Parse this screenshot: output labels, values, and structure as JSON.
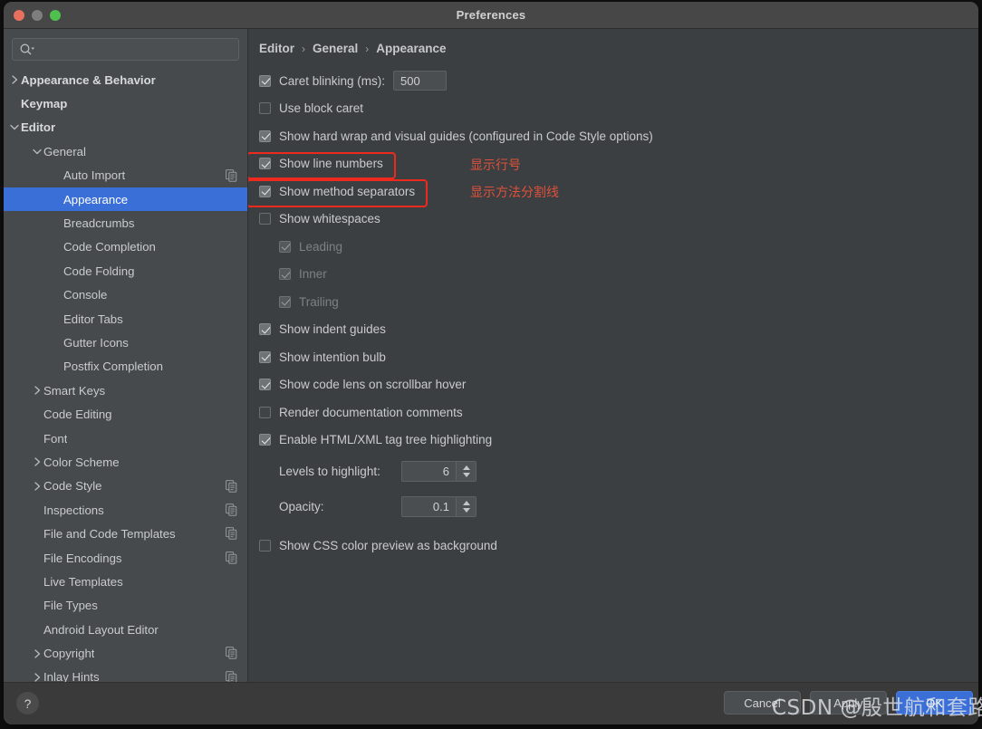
{
  "window": {
    "title": "Preferences",
    "traffic_lights": [
      "close-red",
      "minimize-gray",
      "maximize-green"
    ]
  },
  "search": {
    "value": "",
    "placeholder": "",
    "icon": "search-icon-with-dropdown"
  },
  "sidebar": {
    "items": [
      {
        "label": "Appearance & Behavior",
        "level": 0,
        "twisty": "collapsed",
        "bold": true,
        "selected": false,
        "copy_icon": false
      },
      {
        "label": "Keymap",
        "level": 0,
        "twisty": "none",
        "bold": true,
        "selected": false,
        "copy_icon": false
      },
      {
        "label": "Editor",
        "level": 0,
        "twisty": "expanded",
        "bold": true,
        "selected": false,
        "copy_icon": false
      },
      {
        "label": "General",
        "level": 1,
        "twisty": "expanded",
        "bold": false,
        "selected": false,
        "copy_icon": false
      },
      {
        "label": "Auto Import",
        "level": 2,
        "twisty": "none",
        "bold": false,
        "selected": false,
        "copy_icon": true
      },
      {
        "label": "Appearance",
        "level": 2,
        "twisty": "none",
        "bold": false,
        "selected": true,
        "copy_icon": false
      },
      {
        "label": "Breadcrumbs",
        "level": 2,
        "twisty": "none",
        "bold": false,
        "selected": false,
        "copy_icon": false
      },
      {
        "label": "Code Completion",
        "level": 2,
        "twisty": "none",
        "bold": false,
        "selected": false,
        "copy_icon": false
      },
      {
        "label": "Code Folding",
        "level": 2,
        "twisty": "none",
        "bold": false,
        "selected": false,
        "copy_icon": false
      },
      {
        "label": "Console",
        "level": 2,
        "twisty": "none",
        "bold": false,
        "selected": false,
        "copy_icon": false
      },
      {
        "label": "Editor Tabs",
        "level": 2,
        "twisty": "none",
        "bold": false,
        "selected": false,
        "copy_icon": false
      },
      {
        "label": "Gutter Icons",
        "level": 2,
        "twisty": "none",
        "bold": false,
        "selected": false,
        "copy_icon": false
      },
      {
        "label": "Postfix Completion",
        "level": 2,
        "twisty": "none",
        "bold": false,
        "selected": false,
        "copy_icon": false
      },
      {
        "label": "Smart Keys",
        "level": 1,
        "twisty": "collapsed",
        "bold": false,
        "selected": false,
        "copy_icon": false
      },
      {
        "label": "Code Editing",
        "level": 1,
        "twisty": "none",
        "bold": false,
        "selected": false,
        "copy_icon": false
      },
      {
        "label": "Font",
        "level": 1,
        "twisty": "none",
        "bold": false,
        "selected": false,
        "copy_icon": false
      },
      {
        "label": "Color Scheme",
        "level": 1,
        "twisty": "collapsed",
        "bold": false,
        "selected": false,
        "copy_icon": false
      },
      {
        "label": "Code Style",
        "level": 1,
        "twisty": "collapsed",
        "bold": false,
        "selected": false,
        "copy_icon": true
      },
      {
        "label": "Inspections",
        "level": 1,
        "twisty": "none",
        "bold": false,
        "selected": false,
        "copy_icon": true
      },
      {
        "label": "File and Code Templates",
        "level": 1,
        "twisty": "none",
        "bold": false,
        "selected": false,
        "copy_icon": true
      },
      {
        "label": "File Encodings",
        "level": 1,
        "twisty": "none",
        "bold": false,
        "selected": false,
        "copy_icon": true
      },
      {
        "label": "Live Templates",
        "level": 1,
        "twisty": "none",
        "bold": false,
        "selected": false,
        "copy_icon": false
      },
      {
        "label": "File Types",
        "level": 1,
        "twisty": "none",
        "bold": false,
        "selected": false,
        "copy_icon": false
      },
      {
        "label": "Android Layout Editor",
        "level": 1,
        "twisty": "none",
        "bold": false,
        "selected": false,
        "copy_icon": false
      },
      {
        "label": "Copyright",
        "level": 1,
        "twisty": "collapsed",
        "bold": false,
        "selected": false,
        "copy_icon": true
      },
      {
        "label": "Inlay Hints",
        "level": 1,
        "twisty": "collapsed",
        "bold": false,
        "selected": false,
        "copy_icon": true
      }
    ]
  },
  "breadcrumb": {
    "parts": [
      "Editor",
      "General",
      "Appearance"
    ],
    "separator": "›"
  },
  "options": [
    {
      "label": "Caret blinking (ms):",
      "checkbox": "checked",
      "disabled": false,
      "indent": 0
    },
    {
      "label": "Use block caret",
      "checkbox": "unchecked",
      "disabled": false,
      "indent": 0
    },
    {
      "label": "Show hard wrap and visual guides (configured in Code Style options)",
      "checkbox": "checked",
      "disabled": false,
      "indent": 0
    },
    {
      "label": "Show line numbers",
      "checkbox": "checked",
      "disabled": false,
      "indent": 0
    },
    {
      "label": "Show method separators",
      "checkbox": "checked",
      "disabled": false,
      "indent": 0
    },
    {
      "label": "Show whitespaces",
      "checkbox": "unchecked",
      "disabled": false,
      "indent": 0
    },
    {
      "label": "Leading",
      "checkbox": "checked",
      "disabled": true,
      "indent": 1
    },
    {
      "label": "Inner",
      "checkbox": "checked",
      "disabled": true,
      "indent": 1
    },
    {
      "label": "Trailing",
      "checkbox": "checked",
      "disabled": true,
      "indent": 1
    },
    {
      "label": "Show indent guides",
      "checkbox": "checked",
      "disabled": false,
      "indent": 0
    },
    {
      "label": "Show intention bulb",
      "checkbox": "checked",
      "disabled": false,
      "indent": 0
    },
    {
      "label": "Show code lens on scrollbar hover",
      "checkbox": "checked",
      "disabled": false,
      "indent": 0
    },
    {
      "label": "Render documentation comments",
      "checkbox": "unchecked",
      "disabled": false,
      "indent": 0
    },
    {
      "label": "Enable HTML/XML tag tree highlighting",
      "checkbox": "checked",
      "disabled": false,
      "indent": 0
    }
  ],
  "fields": {
    "caret_blinking_value": "500"
  },
  "spinners": [
    {
      "label": "Levels to highlight:",
      "value": "6"
    },
    {
      "label": "Opacity:",
      "value": "0.1"
    }
  ],
  "trailing_option": {
    "label": "Show CSS color preview as background",
    "checkbox": "unchecked"
  },
  "annotations": {
    "boxes": [
      "show-line-numbers",
      "show-method-separators"
    ],
    "notes": [
      {
        "text": "显示行号"
      },
      {
        "text": "显示方法分割线"
      }
    ],
    "color_box": "#ee2a1e",
    "color_text": "#e0503c"
  },
  "footer": {
    "help_label": "?",
    "cancel_label": "Cancel",
    "apply_label": "Apply",
    "ok_label": "OK"
  },
  "watermark": {
    "text": "CSDN @殷世航和套路璐"
  },
  "colors": {
    "accent_blue": "#3a6fd8",
    "window_bg": "#3c3f41",
    "sidebar_bg": "#464a4d",
    "titlebar_bg": "#474747",
    "footer_bg": "#3a3a3a"
  }
}
